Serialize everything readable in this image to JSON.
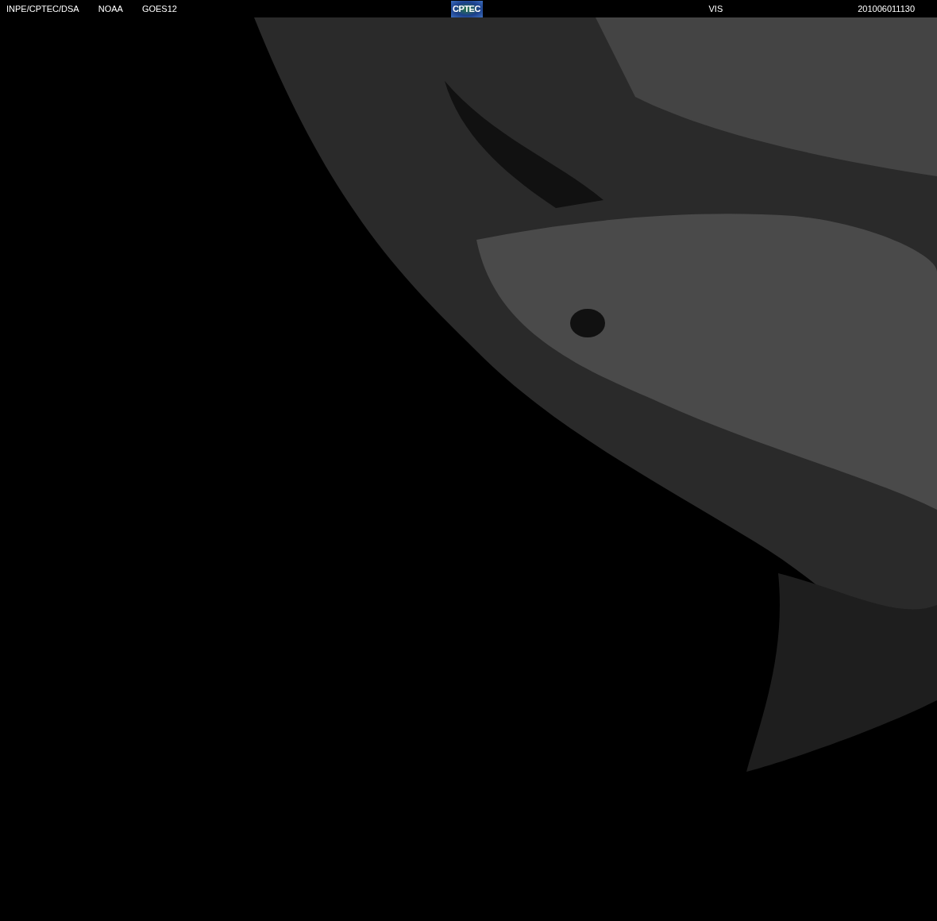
{
  "header": {
    "left_labels": [
      "INPE/CPTEC/DSA",
      "NOAA",
      "GOES12"
    ],
    "logo": "CPTEC",
    "channel": "VIS",
    "timestamp": "201006011130"
  }
}
